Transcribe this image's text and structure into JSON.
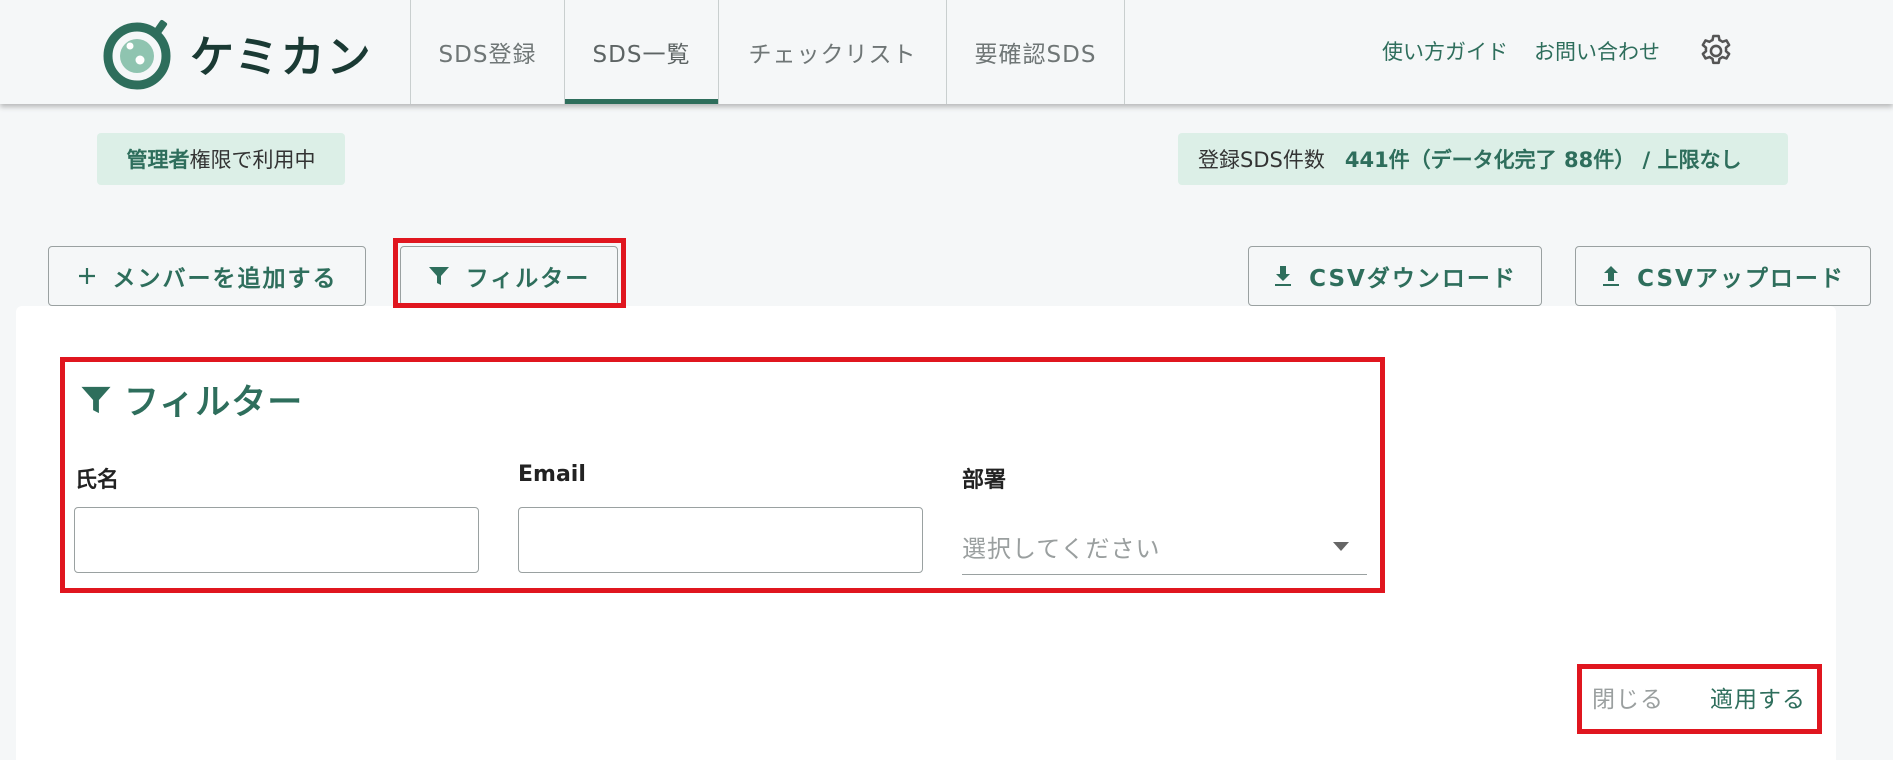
{
  "brand": {
    "name": "ケミカン",
    "color": "#2e6e5c"
  },
  "nav": {
    "tabs": [
      {
        "label": "SDS登録",
        "active": false
      },
      {
        "label": "SDS一覧",
        "active": true
      },
      {
        "label": "チェックリスト",
        "active": false
      },
      {
        "label": "要確認SDS",
        "active": false
      }
    ],
    "links": [
      "使い方ガイド",
      "お問い合わせ"
    ],
    "settings_icon": "gear-icon"
  },
  "status": {
    "role_bold": "管理者",
    "role_rest": "権限で利用中",
    "count_label": "登録SDS件数",
    "count_value": "441件（データ化完了 88件） / 上限なし"
  },
  "actions": {
    "add_member": "メンバーを追加する",
    "filter": "フィルター",
    "csv_download": "CSVダウンロード",
    "csv_upload": "CSVアップロード"
  },
  "filter_panel": {
    "title": "フィルター",
    "fields": {
      "name": {
        "label": "氏名",
        "value": ""
      },
      "email": {
        "label": "Email",
        "value": ""
      },
      "department": {
        "label": "部署",
        "placeholder": "選択してください"
      }
    },
    "close": "閉じる",
    "apply": "適用する"
  },
  "highlight_color": "#e0161f"
}
